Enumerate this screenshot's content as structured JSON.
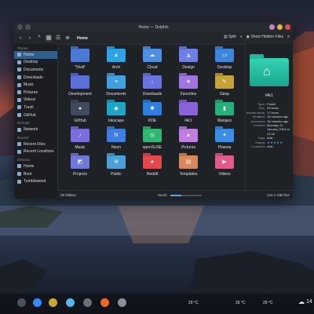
{
  "window": {
    "title": "Home — Dolphin",
    "breadcrumb": "Home",
    "split_label": "Split",
    "hidden_label": "Show Hidden Files"
  },
  "sidebar": {
    "sections": [
      {
        "title": "Places",
        "items": [
          "Home",
          "Desktop",
          "Documents",
          "Downloads",
          "Music",
          "Pictures",
          "Videos",
          "Trash",
          "GitHub"
        ]
      },
      {
        "title": "Remote",
        "items": [
          "Network"
        ]
      },
      {
        "title": "Recent",
        "items": [
          "Recent Files",
          "Recent Locations"
        ]
      },
      {
        "title": "Devices",
        "items": [
          "Home",
          "Boot",
          "Tumbleweed"
        ]
      }
    ]
  },
  "folders": [
    {
      "name": "\"Vivid\"",
      "icon": "folder-icon",
      "color": "#4b79d6",
      "glyph": ""
    },
    {
      "name": "Arch",
      "icon": "arch-icon",
      "color": "#2ea3e6",
      "glyph": "▲"
    },
    {
      "name": "Cloud",
      "icon": "cloud-icon",
      "color": "#4e8fe3",
      "glyph": "☁"
    },
    {
      "name": "Design",
      "icon": "design-icon",
      "color": "#6e7fe6",
      "glyph": "◮"
    },
    {
      "name": "Desktop",
      "icon": "desktop-icon",
      "color": "#3c86de",
      "glyph": "▭"
    },
    {
      "name": "Development",
      "icon": "development-icon",
      "color": "#5b6fd8",
      "glyph": ""
    },
    {
      "name": "Documents",
      "icon": "documents-icon",
      "color": "#43a0e0",
      "glyph": "≡"
    },
    {
      "name": "Downloads",
      "icon": "downloads-icon",
      "color": "#6a74e0",
      "glyph": "↓"
    },
    {
      "name": "Favorites",
      "icon": "favorites-icon",
      "color": "#a274e0",
      "glyph": "★"
    },
    {
      "name": "Gimp",
      "icon": "gimp-icon",
      "color": "#c7a23a",
      "glyph": "✎"
    },
    {
      "name": "GitHub",
      "icon": "github-icon",
      "color": "#3f4a5c",
      "glyph": "●"
    },
    {
      "name": "Inkscape",
      "icon": "inkscape-icon",
      "color": "#1fa6c7",
      "glyph": "◆"
    },
    {
      "name": "KDE",
      "icon": "kde-icon",
      "color": "#2d7fe0",
      "glyph": "✱"
    },
    {
      "name": "l4k1",
      "icon": "folder-icon",
      "color": "#8a63d6",
      "glyph": ""
    },
    {
      "name": "Manjaro",
      "icon": "manjaro-icon",
      "color": "#26b07a",
      "glyph": "▮"
    },
    {
      "name": "Music",
      "icon": "music-icon",
      "color": "#7b6fe0",
      "glyph": "♪"
    },
    {
      "name": "Neon",
      "icon": "neon-icon",
      "color": "#3f7fe3",
      "glyph": "N"
    },
    {
      "name": "openSUSE",
      "icon": "opensuse-icon",
      "color": "#2fb872",
      "glyph": "◎"
    },
    {
      "name": "Pictures",
      "icon": "pictures-icon",
      "color": "#c07ee0",
      "glyph": "▲"
    },
    {
      "name": "Plasma",
      "icon": "plasma-icon",
      "color": "#3a8ee6",
      "glyph": "✦"
    },
    {
      "name": "Projects",
      "icon": "projects-icon",
      "color": "#6e79da",
      "glyph": "◩"
    },
    {
      "name": "Public",
      "icon": "public-icon",
      "color": "#4aa0d8",
      "glyph": "⊕"
    },
    {
      "name": "Reddit",
      "icon": "reddit-icon",
      "color": "#e04a4a",
      "glyph": "●"
    },
    {
      "name": "Templates",
      "icon": "templates-icon",
      "color": "#d88a5a",
      "glyph": "▤"
    },
    {
      "name": "Videos",
      "icon": "videos-icon",
      "color": "#e05a8a",
      "glyph": "▶"
    }
  ],
  "info": {
    "name": "l4k1",
    "props": [
      {
        "k": "Type:",
        "v": "Folder"
      },
      {
        "k": "Size:",
        "v": "25 items"
      },
      {
        "k": "Hidden items:",
        "v": "17 items"
      },
      {
        "k": "Modified:",
        "v": "16 minutes ago"
      },
      {
        "k": "Accessed:",
        "v": "16 minutes ago"
      },
      {
        "k": "Created:",
        "v": "Monday, 22 January 2024 at 21:40"
      },
      {
        "k": "Tags:",
        "v": "Add..."
      },
      {
        "k": "Rating:",
        "v": "★★★★★"
      },
      {
        "k": "Comment:",
        "v": "Add..."
      }
    ]
  },
  "status": {
    "count": "25 folders",
    "zoom_label": "Zoom:",
    "zoom_level": 0.35,
    "free": "124.1 GiB free"
  },
  "taskbar": {
    "weather1": "29 °C",
    "weather2": "29 °C",
    "weather3": "29 °C",
    "clock": "14"
  }
}
